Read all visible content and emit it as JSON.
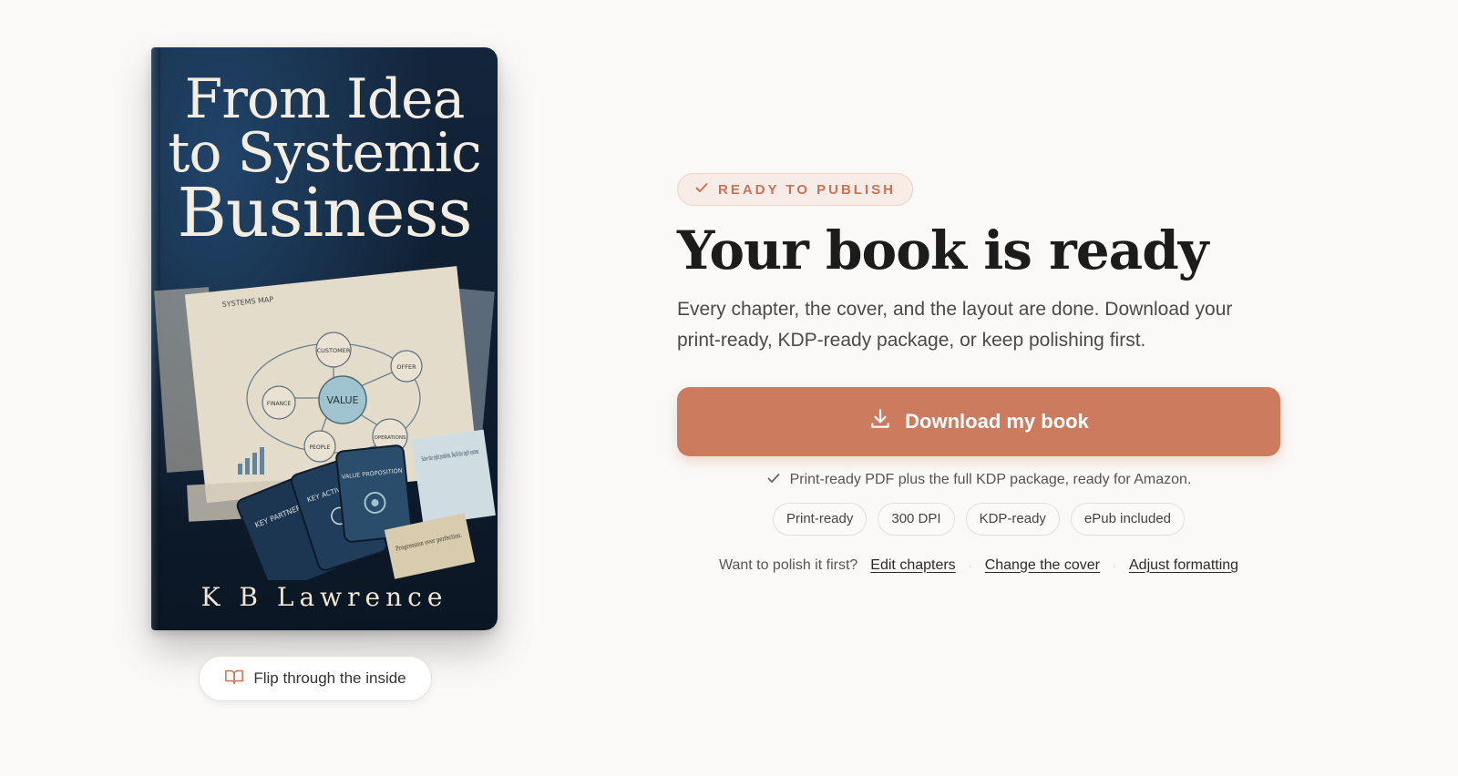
{
  "book": {
    "title_line1": "From Idea",
    "title_line2": "to Systemic",
    "title_line3": "Business",
    "author": "K B Lawrence",
    "art_labels": {
      "systems_map": "SYSTEMS MAP",
      "customer": "CUSTOMER",
      "offer": "OFFER",
      "value": "VALUE",
      "finance": "FINANCE",
      "people": "PEOPLE",
      "operations": "OPERATIONS",
      "key_partners": "KEY PARTNERS",
      "key_activities": "KEY ACTIVITIES",
      "value_proposition": "VALUE PROPOSITION",
      "note1": "Solve the right problem. Build the right system.",
      "note2": "Progression over perfection."
    }
  },
  "flip_button": {
    "label": "Flip through the inside",
    "icon": "open-book-icon"
  },
  "badge": {
    "label": "READY TO PUBLISH",
    "icon": "check-icon"
  },
  "headline": "Your book is ready",
  "subtext": "Every chapter, the cover, and the layout are done. Download your print-ready, KDP-ready package, or keep polishing first.",
  "download_button": {
    "label": "Download my book",
    "icon": "download-icon"
  },
  "note": "Print-ready PDF plus the full KDP package, ready for Amazon.",
  "chips": [
    "Print-ready",
    "300 DPI",
    "KDP-ready",
    "ePub included"
  ],
  "polish": {
    "prompt": "Want to polish it first?",
    "links": [
      "Edit chapters",
      "Change the cover",
      "Adjust formatting"
    ],
    "separator": "·"
  },
  "colors": {
    "background": "#faf9f7",
    "accent": "#cd7b5e",
    "badge_text": "#c9725a",
    "badge_bg": "#f8ece6",
    "cover_bg": "#0f1e30"
  }
}
